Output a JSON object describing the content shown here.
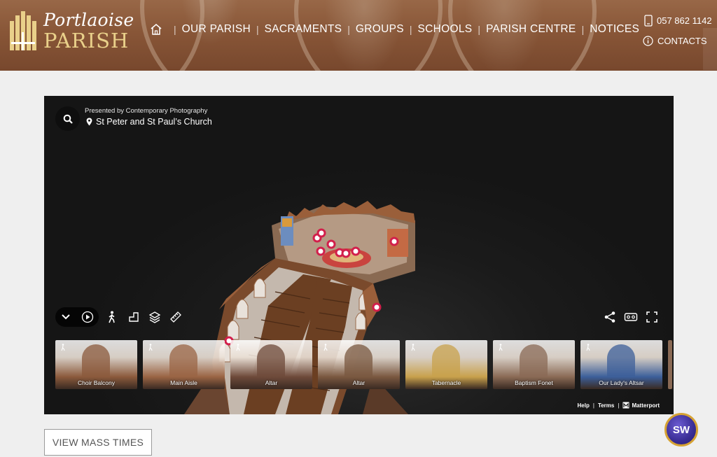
{
  "header": {
    "logo_title": "Portlaoise",
    "logo_subtitle": "PARISH",
    "nav": [
      {
        "label": "OUR PARISH"
      },
      {
        "label": "SACRAMENTS"
      },
      {
        "label": "GROUPS"
      },
      {
        "label": "SCHOOLS"
      },
      {
        "label": "PARISH CENTRE"
      },
      {
        "label": "NOTICES"
      }
    ],
    "phone": "057 862 1142",
    "contacts": "CONTACTS"
  },
  "viewer": {
    "presented_by": "Presented by Contemporary Photography",
    "location": "St Peter and St Paul’s Church",
    "thumbnails": [
      {
        "label": "Choir Balcony",
        "tone": "#8b5a3c"
      },
      {
        "label": "Main Aisle",
        "tone": "#9a6444"
      },
      {
        "label": "Altar",
        "tone": "#6e4a3a"
      },
      {
        "label": "Altar",
        "tone": "#7a5840"
      },
      {
        "label": "Tabernacle",
        "tone": "#c8a14c"
      },
      {
        "label": "Baptism Fonet",
        "tone": "#8a6a55"
      },
      {
        "label": "Our Lady's Altsar",
        "tone": "#3c5f9a"
      }
    ],
    "footer": {
      "help": "Help",
      "terms": "Terms",
      "brand": "Matterport"
    }
  },
  "actions": {
    "mass_times": "VIEW MASS TIMES"
  },
  "badge": {
    "text": "SW"
  }
}
